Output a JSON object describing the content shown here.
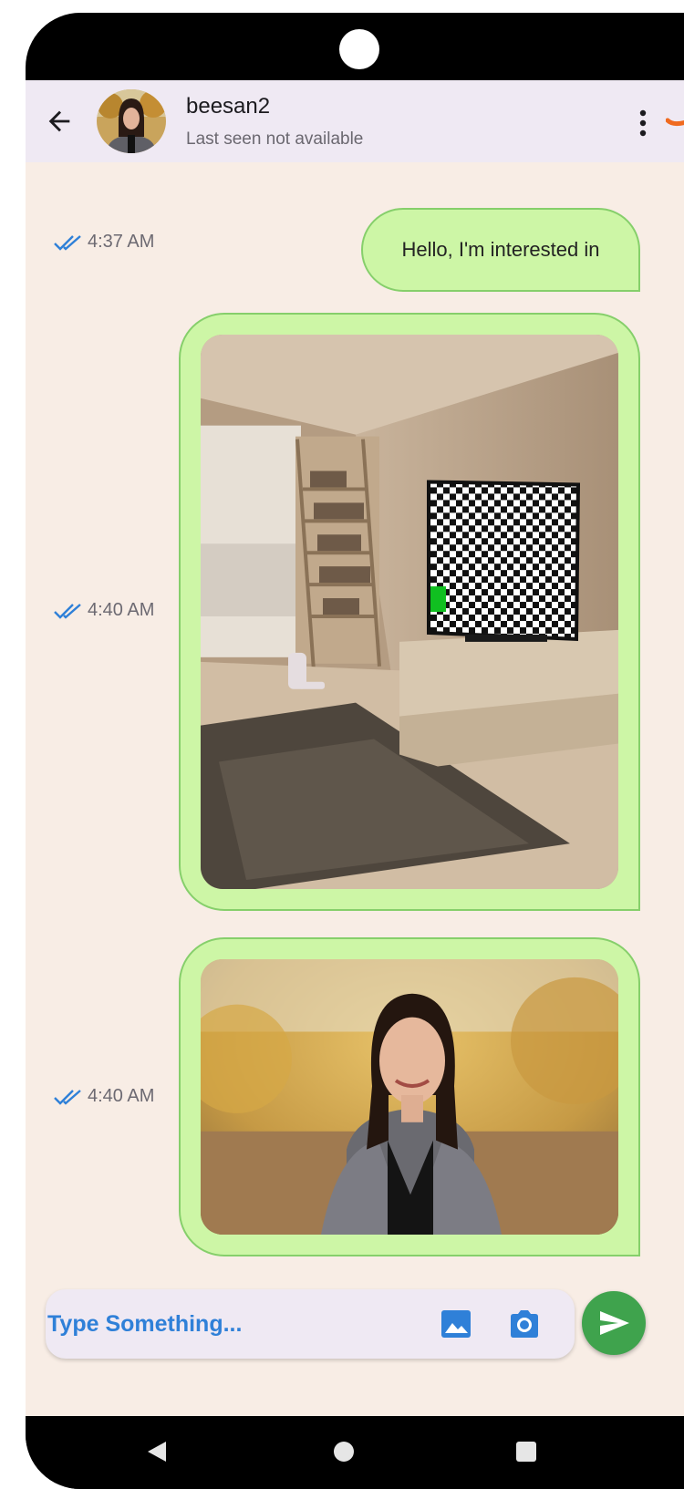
{
  "header": {
    "contact_name": "beesan2",
    "last_seen": "Last seen not available"
  },
  "messages": [
    {
      "type": "text",
      "text": "Hello, I'm interested in",
      "time": "4:37 AM",
      "status": "read"
    },
    {
      "type": "image",
      "time": "4:40 AM",
      "status": "read"
    },
    {
      "type": "image",
      "time": "4:40 AM",
      "status": "read"
    }
  ],
  "composer": {
    "placeholder": "Type Something...",
    "value": ""
  },
  "icons": {
    "back": "arrow-back-icon",
    "menu": "more-vert-icon",
    "read_receipt": "double-check-icon",
    "gallery": "image-icon",
    "camera": "camera-icon",
    "send": "send-icon",
    "nav_back": "nav-back-icon",
    "nav_home": "nav-home-icon",
    "nav_recents": "nav-recents-icon"
  },
  "colors": {
    "chat_background": "#f8ede5",
    "app_bar": "#efe9f3",
    "bubble_fill": "#cdf6a6",
    "bubble_border": "#86cf6b",
    "read_receipt": "#2f80d8",
    "placeholder_text": "#2f80d8",
    "send_button": "#3fa34d"
  }
}
